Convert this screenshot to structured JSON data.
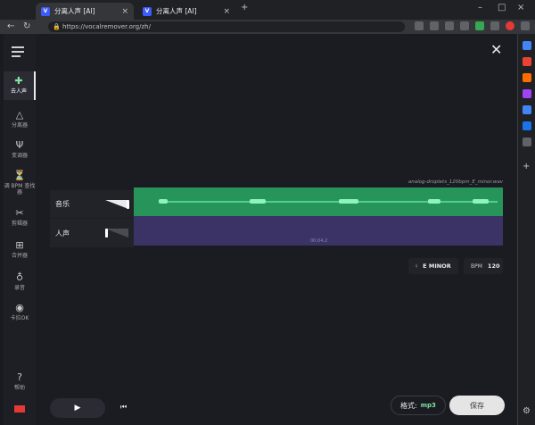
{
  "browser": {
    "tabs": [
      {
        "title": "分离人声 [AI]",
        "active": true
      },
      {
        "title": "分离人声 [AI]",
        "active": false
      }
    ],
    "new_tab": "+",
    "url": "https://vocalremover.org/zh/"
  },
  "sidebar": {
    "items": [
      {
        "label": "去人声",
        "icon": "split-icon",
        "glyph": "✚",
        "active": true
      },
      {
        "label": "分离器",
        "icon": "separator-icon",
        "glyph": "△"
      },
      {
        "label": "变调器",
        "icon": "tuning-fork-icon",
        "glyph": "Ψ"
      },
      {
        "label": "调 BPM 查找器",
        "icon": "metronome-icon",
        "glyph": "⏳"
      },
      {
        "label": "剪辑器",
        "icon": "scissors-icon",
        "glyph": "✂"
      },
      {
        "label": "合并器",
        "icon": "joiner-icon",
        "glyph": "⊞"
      },
      {
        "label": "录音",
        "icon": "microphone-icon",
        "glyph": "♁"
      },
      {
        "label": "卡拉OK",
        "icon": "karaoke-icon",
        "glyph": "◉"
      }
    ],
    "help": {
      "label": "帮助",
      "glyph": "?"
    }
  },
  "editor": {
    "filename": "analog-droplets_120bpm_E_minor.wav",
    "tracks": [
      {
        "label": "音乐"
      },
      {
        "label": "人声"
      }
    ],
    "time_marker": "00:04.2",
    "key_value": "E MINOR",
    "bpm_label": "BPM",
    "bpm_value": "120"
  },
  "bottom": {
    "play_glyph": "▶",
    "prev_glyph": "⏮",
    "format_label": "格式:",
    "format_value": "mp3",
    "save_label": "保存"
  },
  "colors": {
    "music_track": "#27955a",
    "vocal_track": "#3b3366",
    "accent": "#7fe3a1"
  }
}
